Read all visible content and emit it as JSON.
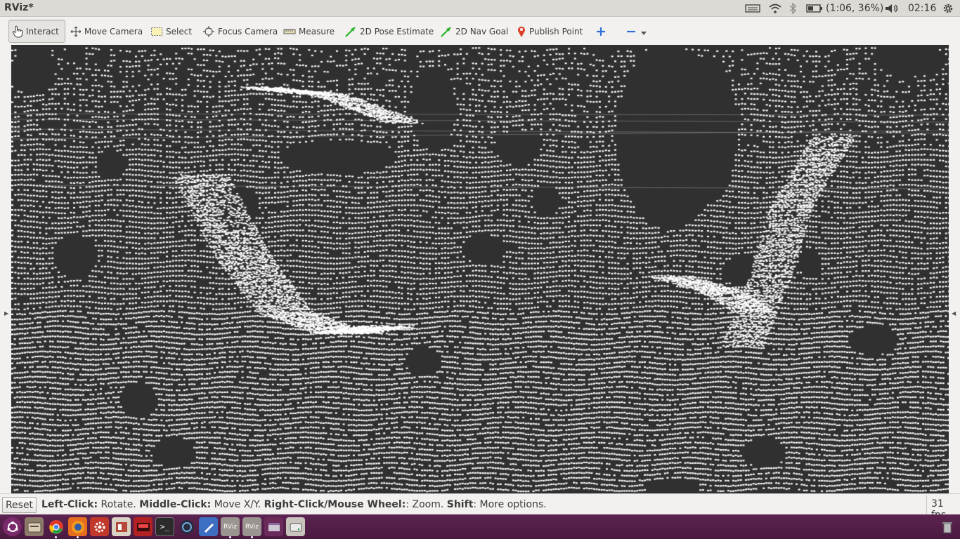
{
  "window": {
    "title": "RViz*"
  },
  "panel": {
    "battery": "(1:06, 36%)",
    "clock": "02:16"
  },
  "toolbar": {
    "tools": [
      {
        "label": "Interact",
        "icon": "hand-pointer-icon",
        "active": true
      },
      {
        "label": "Move Camera",
        "icon": "move-arrows-icon",
        "active": false
      },
      {
        "label": "Select",
        "icon": "select-rect-icon",
        "active": false
      },
      {
        "label": "Focus Camera",
        "icon": "focus-target-icon",
        "active": false
      },
      {
        "label": "Measure",
        "icon": "ruler-icon",
        "active": false
      },
      {
        "label": "2D Pose Estimate",
        "icon": "green-arrow-icon",
        "active": false
      },
      {
        "label": "2D Nav Goal",
        "icon": "green-arrow-icon",
        "active": false
      },
      {
        "label": "Publish Point",
        "icon": "map-pin-icon",
        "active": false
      }
    ],
    "add_tool": "plus-icon",
    "remove_tool": "minus-icon"
  },
  "status": {
    "reset_label": "Reset",
    "hint_parts": [
      {
        "bold": "Left-Click:",
        "text": " Rotate. "
      },
      {
        "bold": "Middle-Click:",
        "text": " Move X/Y. "
      },
      {
        "bold": "Right-Click/Mouse Wheel:",
        "text": ": Zoom. "
      },
      {
        "bold": "Shift",
        "text": ": More options."
      }
    ],
    "fps": "31 fps"
  },
  "colors": {
    "viewport_bg": "#303030",
    "points": "#ffffff",
    "launcher_bg": "#4a1a41"
  },
  "launcher": {
    "apps": [
      "ubuntu-dash-icon",
      "files-icon",
      "chrome-icon",
      "firefox-icon",
      "settings-icon",
      "app-icon",
      "app-icon",
      "terminal-icon",
      "app-icon",
      "editor-icon",
      "rviz-icon",
      "rviz-icon",
      "app-icon",
      "drive-icon"
    ],
    "rviz_label": "RViz",
    "trash": "trash-icon"
  }
}
